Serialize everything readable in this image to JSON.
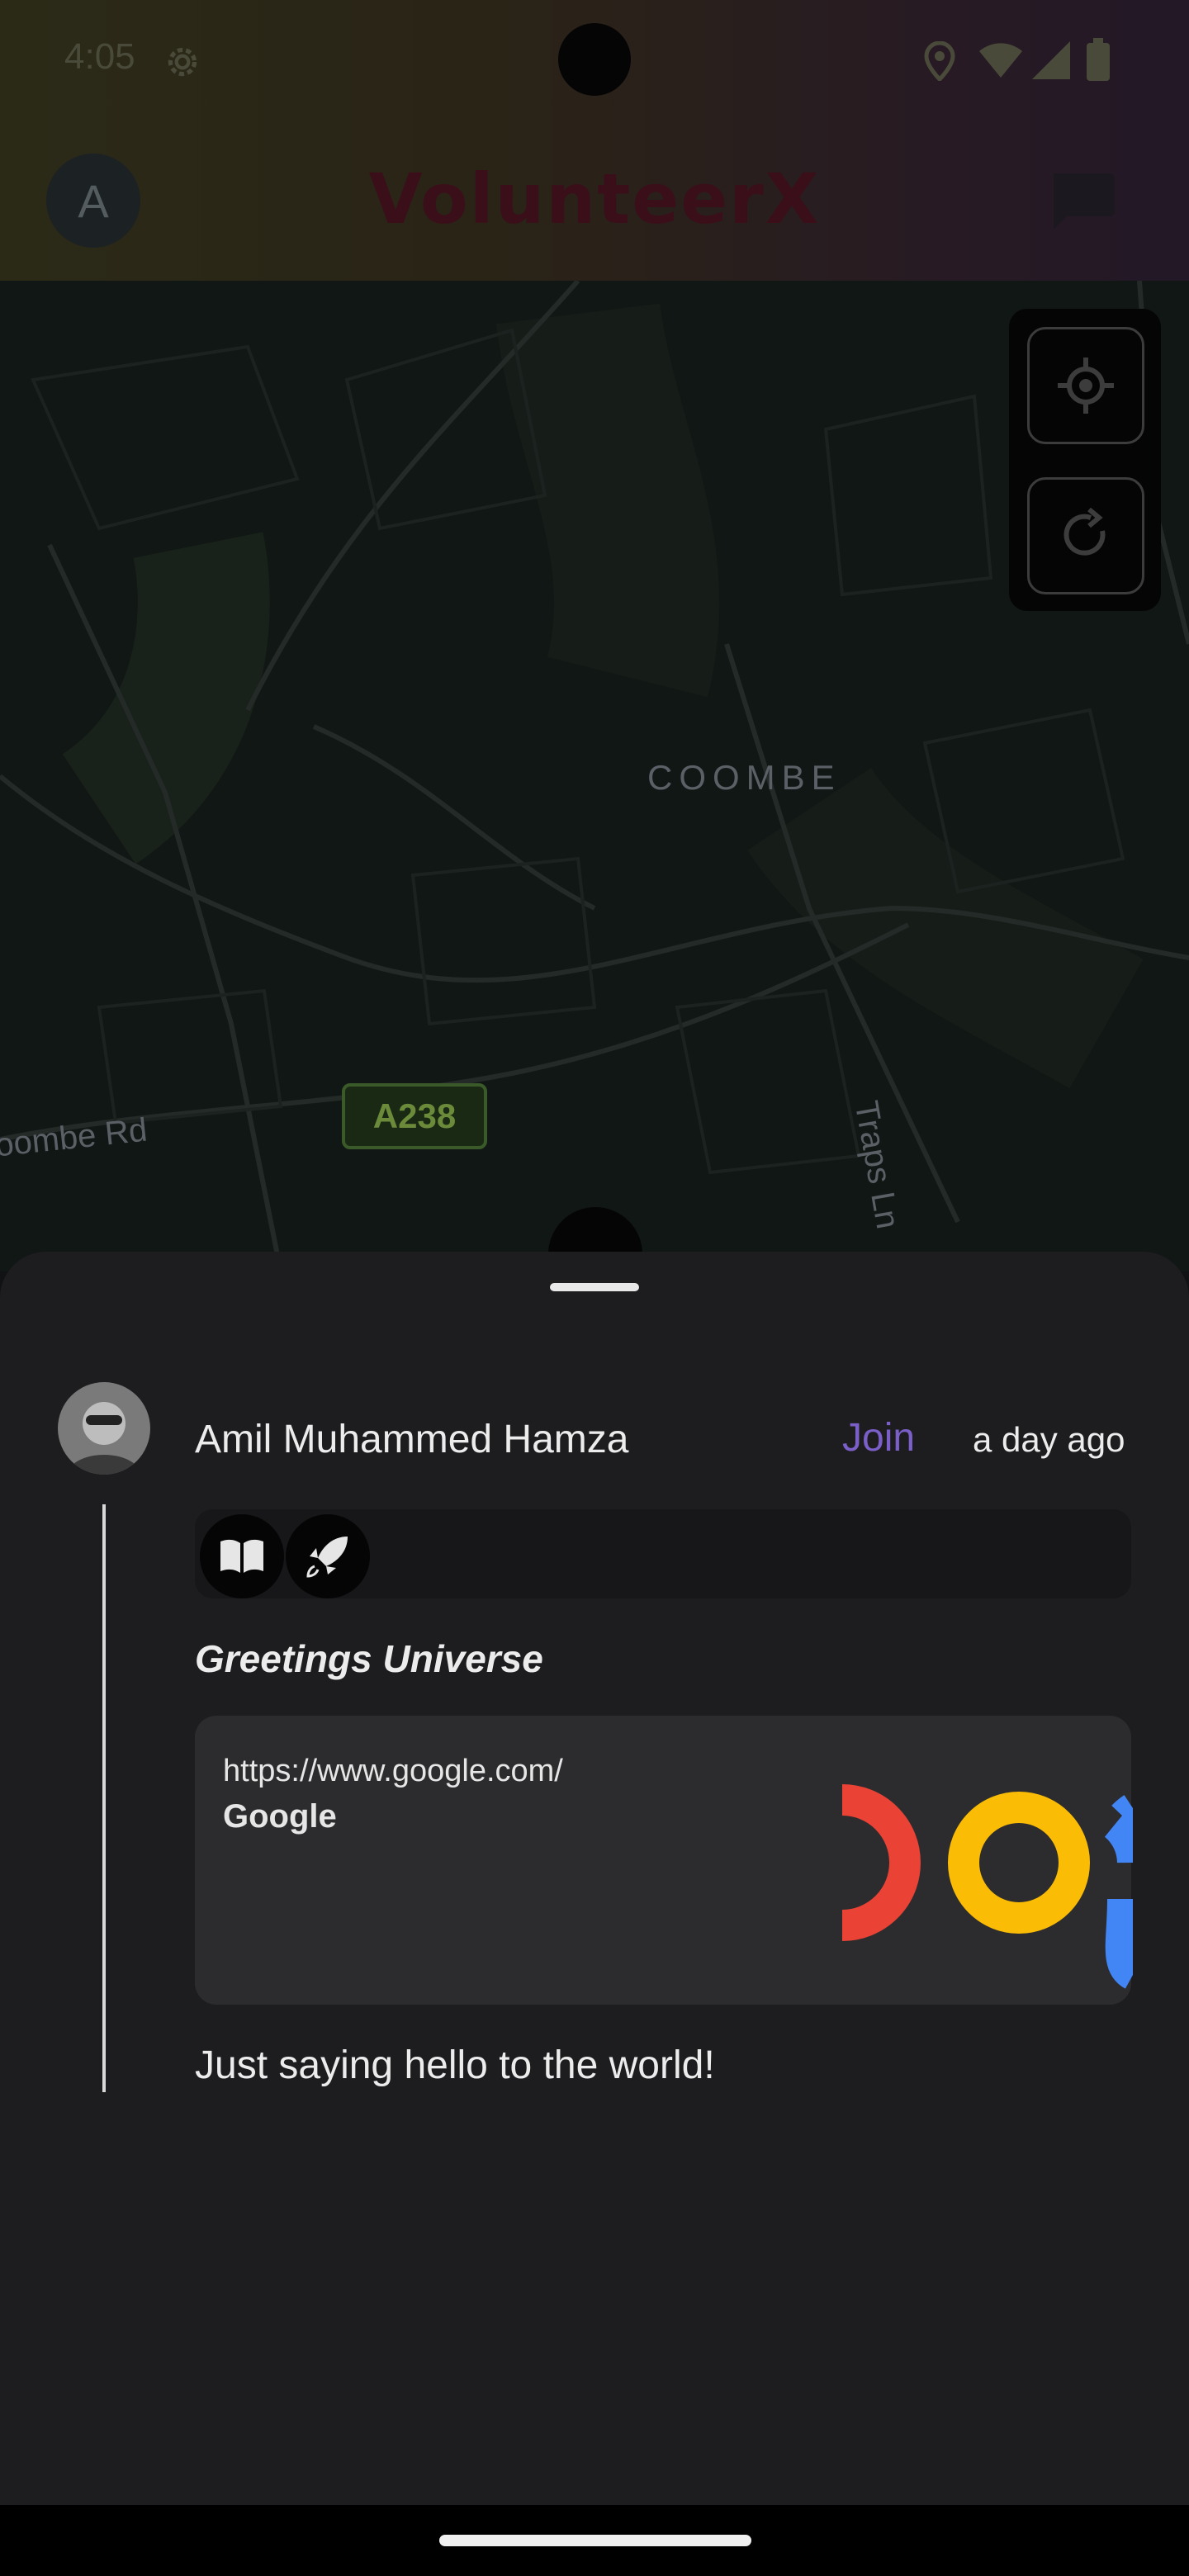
{
  "status_bar": {
    "time": "4:05"
  },
  "app_bar": {
    "avatar_letter": "A",
    "title": "VolunteerX"
  },
  "map": {
    "labels": {
      "area": "COOMBE",
      "street": "Traps Ln",
      "road": "oombe Rd"
    },
    "road_badge": "A238"
  },
  "post": {
    "author": "Amil Muhammed Hamza",
    "join_label": "Join",
    "time": "a day ago",
    "tags": [
      "book-icon",
      "rocket-icon"
    ],
    "title": "Greetings Universe",
    "link": {
      "url": "https://www.google.com/",
      "title": "Google"
    },
    "body": "Just saying hello to the world!"
  },
  "colors": {
    "accent": "#7a5fc8",
    "sheet": "#1d1d20",
    "card": "#2c2c2e"
  }
}
